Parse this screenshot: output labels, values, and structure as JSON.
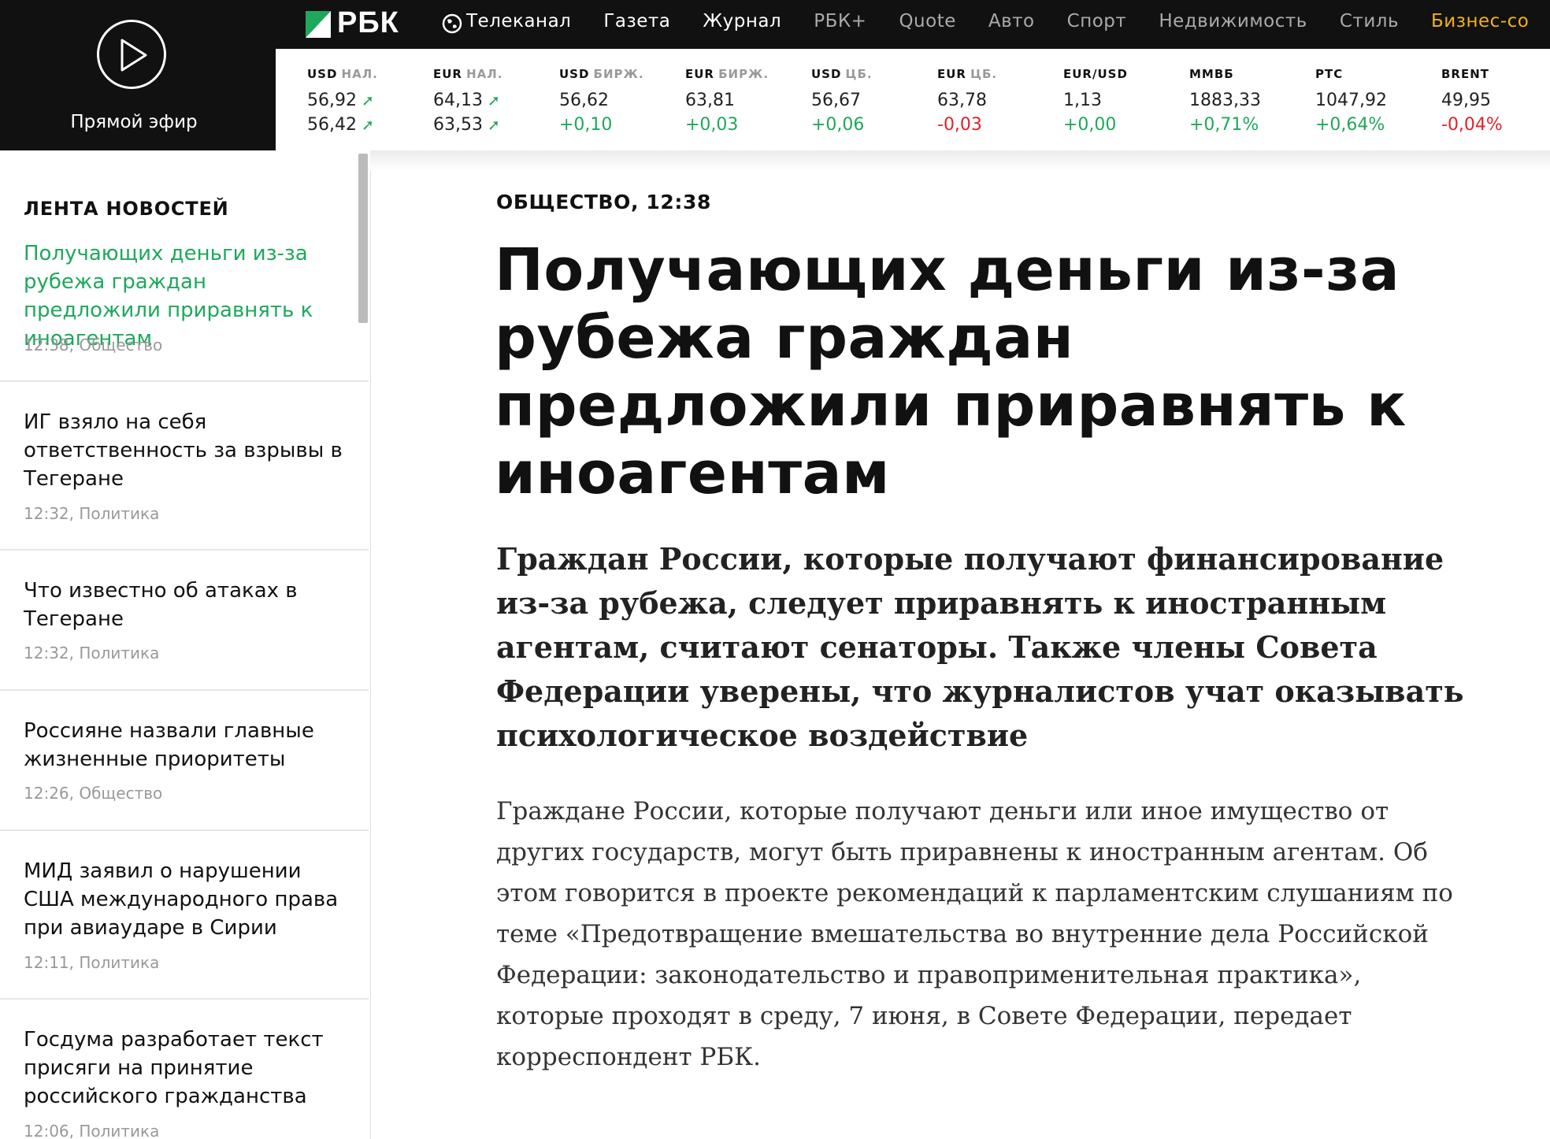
{
  "header": {
    "live_label": "Прямой эфир",
    "logo_text": "РБК",
    "nav": [
      "Телеканал",
      "Газета",
      "Журнал",
      "РБК+",
      "Quote",
      "Авто",
      "Спорт",
      "Недвижимость",
      "Стиль",
      "Бизнес-со"
    ]
  },
  "ticker": [
    {
      "name": "USD",
      "sub": "НАЛ.",
      "v1": "56,92",
      "v2": "56,42"
    },
    {
      "name": "EUR",
      "sub": "НАЛ.",
      "v1": "64,13",
      "v2": "63,53"
    },
    {
      "name": "USD",
      "sub": "БИРЖ.",
      "v1": "56,62",
      "v2": "+0,10"
    },
    {
      "name": "EUR",
      "sub": "БИРЖ.",
      "v1": "63,81",
      "v2": "+0,03"
    },
    {
      "name": "USD",
      "sub": "ЦБ.",
      "v1": "56,67",
      "v2": "+0,06"
    },
    {
      "name": "EUR",
      "sub": "ЦБ.",
      "v1": "63,78",
      "v2": "-0,03"
    },
    {
      "name": "EUR/USD",
      "sub": "",
      "v1": "1,13",
      "v2": "+0,00"
    },
    {
      "name": "ММВБ",
      "sub": "",
      "v1": "1883,33",
      "v2": "+0,71%"
    },
    {
      "name": "РТС",
      "sub": "",
      "v1": "1047,92",
      "v2": "+0,64%"
    },
    {
      "name": "BRENT",
      "sub": "",
      "v1": "49,95",
      "v2": "-0,04%"
    }
  ],
  "feed": {
    "title": "ЛЕНТА НОВОСТЕЙ",
    "items": [
      {
        "title": "Получающих деньги из-за рубежа граждан предложили приравнять к иноагентам",
        "meta": "12:38, Общество"
      },
      {
        "title": "ИГ взяло на себя ответственность за взрывы в Тегеране",
        "meta": "12:32, Политика"
      },
      {
        "title": "Что известно об атаках в Тегеране",
        "meta": "12:32, Политика"
      },
      {
        "title": "Россияне назвали главные жизненные приоритеты",
        "meta": "12:26, Общество"
      },
      {
        "title": "МИД заявил о нарушении США международного права при авиаударе в Сирии",
        "meta": "12:11, Политика"
      },
      {
        "title": "Госдума разработает текст присяги на принятие российского гражданства",
        "meta": "12:06, Политика"
      }
    ]
  },
  "article": {
    "rubric": "ОБЩЕСТВО, 12:38",
    "headline": "Получающих деньги из-за рубежа граждан предложили приравнять к иноагентам",
    "lead": "Граждан России, которые получают финансирование из-за рубежа, следует приравнять к иностранным агентам, считают сенаторы. Также члены Совета Федерации уверены, что журналистов учат оказывать психологическое воздействие",
    "body": "Граждане России, которые получают деньги или иное имущество от других государств, могут быть приравнены к иностранным агентам. Об этом говорится в проекте рекомендаций к парламентским слушаниям по теме «Предотвращение вмешательства во внутренние дела Российской Федерации: законодательство и правоприменительная практика», которые проходят в среду, 7 июня, в Совете Федерации, передает корреспондент РБК."
  },
  "colors": {
    "accent_green": "#1ea85c",
    "negative_red": "#e0222a",
    "nav_gold": "#f2b01e",
    "header_bg": "#111111"
  }
}
